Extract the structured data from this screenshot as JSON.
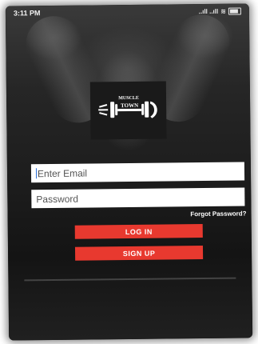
{
  "status_bar": {
    "time": "3:11 PM",
    "signal_text": "..ıll ..ıll",
    "wifi_glyph": "≋",
    "battery_glyph": ""
  },
  "logo": {
    "line1": "MUSCLE",
    "line2": "TOWN"
  },
  "form": {
    "email_placeholder": "Enter Email",
    "password_placeholder": "Password",
    "forgot_password": "Forgot Password?",
    "login_label": "LOG IN",
    "signup_label": "SIGN UP"
  },
  "colors": {
    "accent": "#e8392f",
    "background": "#1c1c1c",
    "input_bg": "#ffffff"
  },
  "icons": [
    "signal-icon",
    "wifi-icon",
    "battery-icon",
    "dumbbell-logo"
  ]
}
